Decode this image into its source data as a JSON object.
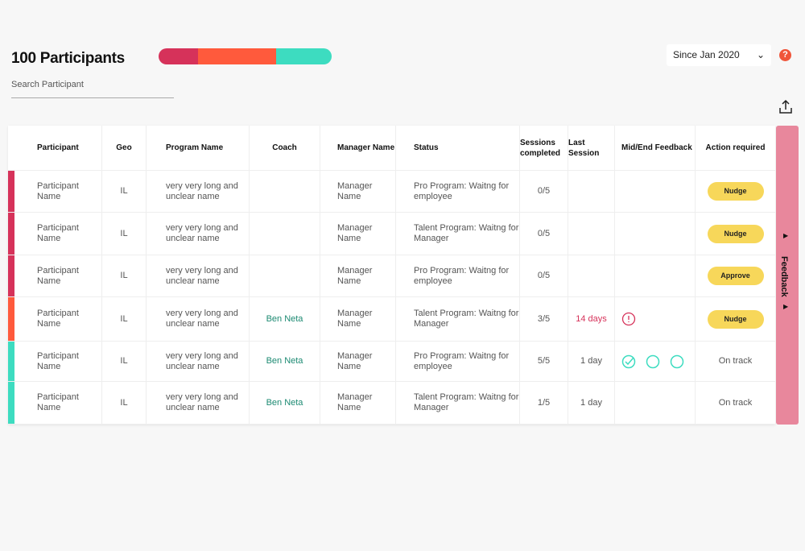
{
  "header": {
    "title": "100 Participants",
    "search_placeholder": "Search Participant",
    "period": "Since Jan 2020",
    "help": "?"
  },
  "progress": {
    "segments": [
      {
        "fraction": 0.23,
        "color": "#d6325a"
      },
      {
        "fraction": 0.45,
        "color": "#ff5a3c"
      },
      {
        "fraction": 0.32,
        "color": "#3ddcc0"
      }
    ]
  },
  "columns": [
    "Participant",
    "Geo",
    "Program Name",
    "Coach",
    "Manager Name",
    "Status",
    "Sessions completed",
    "Last Session",
    "Mid/End Feedback",
    "Action required"
  ],
  "rows": [
    {
      "stripe": "#d6325a",
      "participant": "Participant Name",
      "geo": "IL",
      "program": "very very long and unclear name",
      "coach": "",
      "manager": "Manager Name",
      "status": "Pro Program: Waitng for employee",
      "sessions": "0/5",
      "last": "",
      "feedback": "none",
      "action": "Nudge",
      "action_type": "button"
    },
    {
      "stripe": "#d6325a",
      "participant": "Participant Name",
      "geo": "IL",
      "program": "very very long and unclear name",
      "coach": "",
      "manager": "Manager Name",
      "status": "Talent Program: Waitng for Manager",
      "sessions": "0/5",
      "last": "",
      "feedback": "none",
      "action": "Nudge",
      "action_type": "button"
    },
    {
      "stripe": "#d6325a",
      "participant": "Participant Name",
      "geo": "IL",
      "program": "very very long and unclear name",
      "coach": "",
      "manager": "Manager Name",
      "status": "Pro Program: Waitng for employee",
      "sessions": "0/5",
      "last": "",
      "feedback": "none",
      "action": "Approve",
      "action_type": "button"
    },
    {
      "stripe": "#ff5a3c",
      "participant": "Participant Name",
      "geo": "IL",
      "program": "very very long and unclear name",
      "coach": "Ben Neta",
      "manager": "Manager Name",
      "status": "Talent Program: Waitng for Manager",
      "sessions": "3/5",
      "last": "14 days",
      "last_late": true,
      "feedback": "alert",
      "action": "Nudge",
      "action_type": "button"
    },
    {
      "stripe": "#3ddcc0",
      "participant": "Participant Name",
      "geo": "IL",
      "program": "very very long and unclear name",
      "coach": "Ben Neta",
      "manager": "Manager Name",
      "status": "Pro Program: Waitng for employee",
      "sessions": "5/5",
      "last": "1 day",
      "feedback": "check-circle-circle",
      "action": "On track",
      "action_type": "text"
    },
    {
      "stripe": "#3ddcc0",
      "participant": "Participant Name",
      "geo": "IL",
      "program": "very very long and unclear name",
      "coach": "Ben Neta",
      "manager": "Manager Name",
      "status": "Talent Program: Waitng for Manager",
      "sessions": "1/5",
      "last": "1 day",
      "feedback": "none",
      "action": "On track",
      "action_type": "text"
    }
  ],
  "feedback_tab": {
    "label": "Feedback",
    "color": "#e8879c"
  }
}
